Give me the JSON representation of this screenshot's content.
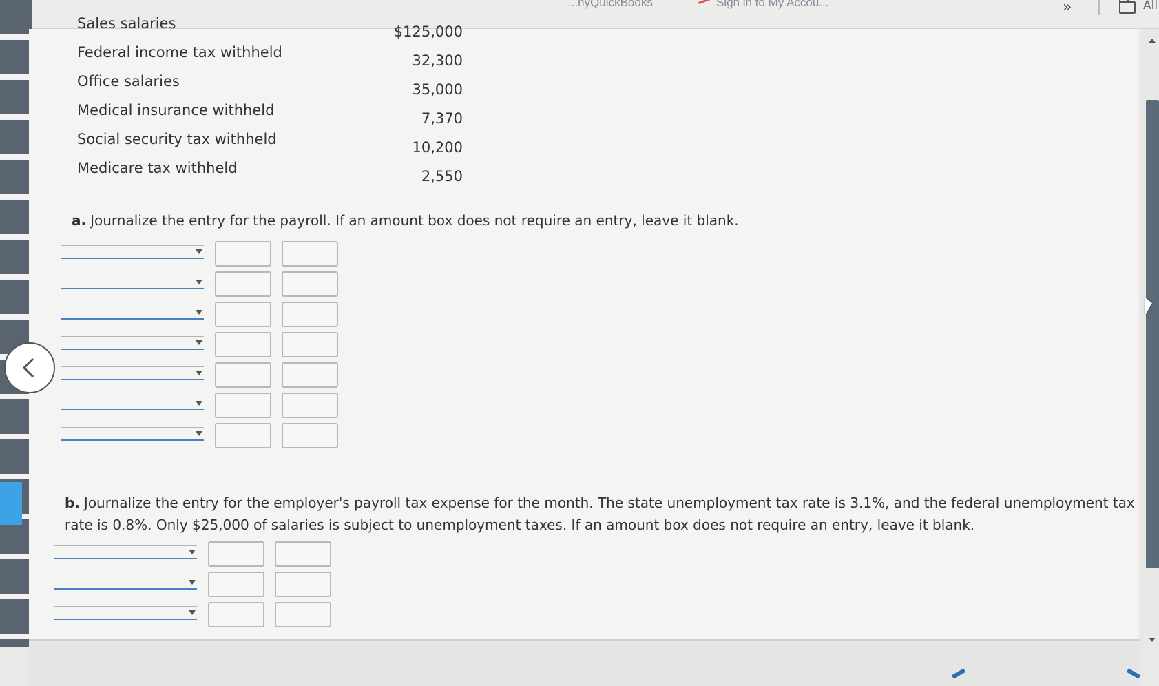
{
  "browser": {
    "bookmarks": [
      "...nyQuickBooks",
      "Sign in to My Accou..."
    ],
    "more_label": "»",
    "all_label": "All"
  },
  "payroll_items": [
    {
      "label": "Sales salaries",
      "value": "$125,000"
    },
    {
      "label": "Federal income tax withheld",
      "value": "32,300"
    },
    {
      "label": "Office salaries",
      "value": "35,000"
    },
    {
      "label": "Medical insurance withheld",
      "value": "7,370"
    },
    {
      "label": "Social security tax withheld",
      "value": "10,200"
    },
    {
      "label": "Medicare tax withheld",
      "value": "2,550"
    }
  ],
  "question_a": {
    "letter": "a.",
    "text": "Journalize the entry for the payroll. If an amount box does not require an entry, leave it blank."
  },
  "question_b": {
    "letter": "b.",
    "text": "Journalize the entry for the employer's payroll tax expense for the month. The state unemployment tax rate is 3.1%, and the federal unemployment tax rate is 0.8%. Only $25,000 of salaries is subject to unemployment taxes. If an amount box does not require an entry, leave it blank."
  },
  "colors": {
    "accent": "#3ea2e6",
    "select_underline": "#4a7fc1",
    "scroll_thumb": "#5c6b7a"
  }
}
